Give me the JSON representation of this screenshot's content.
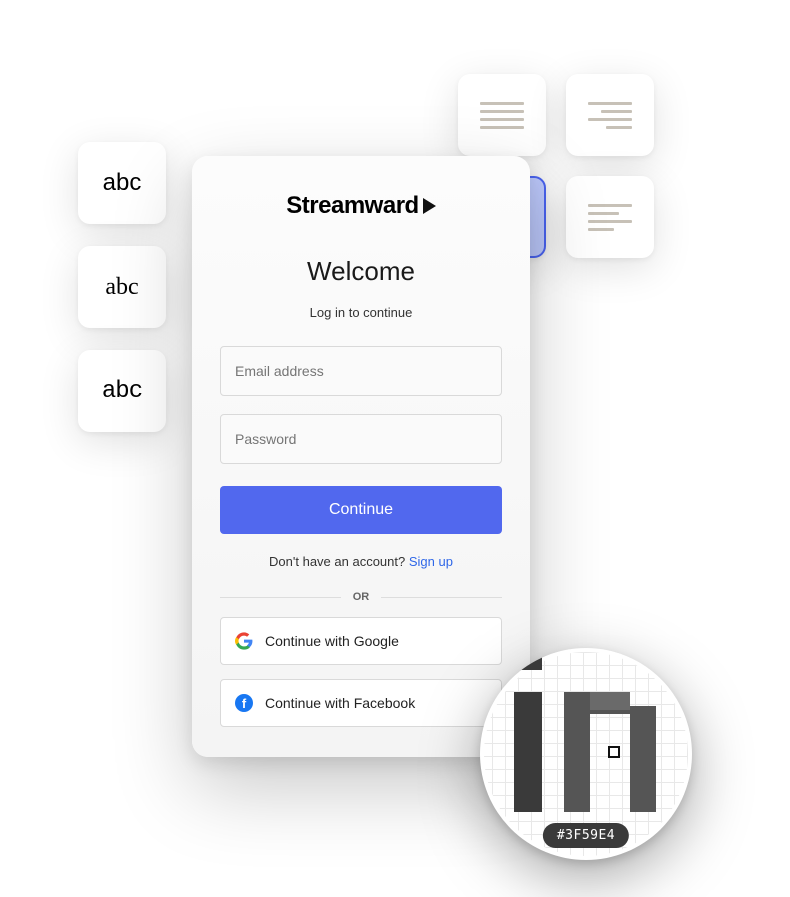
{
  "font_samples": {
    "label": "abc"
  },
  "align": {
    "selected": "center"
  },
  "login": {
    "brand": "Streamward",
    "welcome": "Welcome",
    "subtitle": "Log in to continue",
    "email_placeholder": "Email address",
    "password_placeholder": "Password",
    "continue_label": "Continue",
    "no_account_text": "Don't have an account? ",
    "signup_label": "Sign up",
    "or_label": "OR",
    "google_label": "Continue with Google",
    "facebook_label": "Continue with Facebook"
  },
  "color_picker": {
    "hex": "#3F59E4"
  }
}
